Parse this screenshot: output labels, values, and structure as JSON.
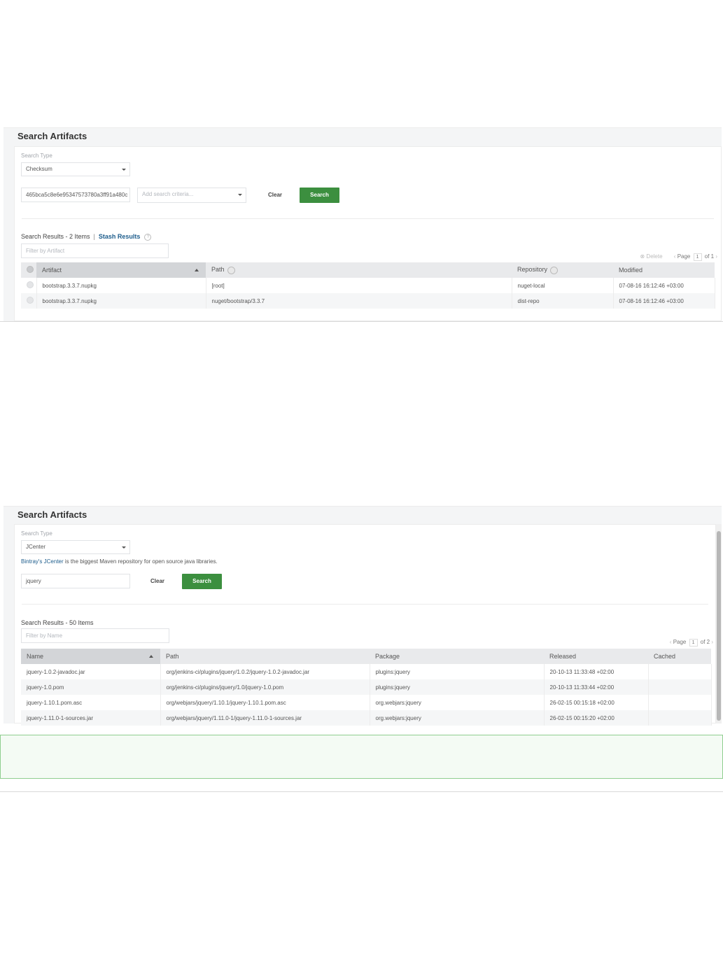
{
  "panel1": {
    "title": "Search Artifacts",
    "search_type_label": "Search Type",
    "search_type_value": "Checksum",
    "checksum_value": "465bca5c8e6e95347573780a3ff91a480c",
    "criteria_placeholder": "Add search criteria...",
    "clear_label": "Clear",
    "search_label": "Search",
    "results_title": "Search Results - 2 Items",
    "stash_label": "Stash Results",
    "filter_placeholder": "Filter by Artifact",
    "delete_label": "Delete",
    "page_label": "Page",
    "page_current": "1",
    "page_total": "of 1",
    "columns": [
      "Artifact",
      "Path",
      "Repository",
      "Modified"
    ],
    "rows": [
      {
        "artifact": "bootstrap.3.3.7.nupkg",
        "path": "[root]",
        "repository": "nuget-local",
        "modified": "07-08-16 16:12:46 +03:00"
      },
      {
        "artifact": "bootstrap.3.3.7.nupkg",
        "path": "nuget/bootstrap/3.3.7",
        "repository": "dist-repo",
        "modified": "07-08-16 16:12:46 +03:00"
      }
    ]
  },
  "panel2": {
    "title": "Search Artifacts",
    "search_type_label": "Search Type",
    "search_type_value": "JCenter",
    "desc_link": "Bintray's JCenter",
    "desc_rest": " is the biggest Maven repository for open source java libraries.",
    "query_value": "jquery",
    "clear_label": "Clear",
    "search_label": "Search",
    "results_title": "Search Results - 50 Items",
    "filter_placeholder": "Filter by Name",
    "page_label": "Page",
    "page_current": "1",
    "page_total": "of 2",
    "columns": [
      "Name",
      "Path",
      "Package",
      "Released",
      "Cached"
    ],
    "rows": [
      {
        "name": "jquery-1.0.2-javadoc.jar",
        "path": "org/jenkins-ci/plugins/jquery/1.0.2/jquery-1.0.2-javadoc.jar",
        "package": "plugins:jquery",
        "released": "20-10-13 11:33:48 +02:00",
        "cached": ""
      },
      {
        "name": "jquery-1.0.pom",
        "path": "org/jenkins-ci/plugins/jquery/1.0/jquery-1.0.pom",
        "package": "plugins:jquery",
        "released": "20-10-13 11:33:44 +02:00",
        "cached": ""
      },
      {
        "name": "jquery-1.10.1.pom.asc",
        "path": "org/webjars/jquery/1.10.1/jquery-1.10.1.pom.asc",
        "package": "org.webjars:jquery",
        "released": "26-02-15 00:15:18 +02:00",
        "cached": ""
      },
      {
        "name": "jquery-1.11.0-1-sources.jar",
        "path": "org/webjars/jquery/1.11.0-1/jquery-1.11.0-1-sources.jar",
        "package": "org.webjars:jquery",
        "released": "26-02-15 00:15:20 +02:00",
        "cached": ""
      }
    ]
  },
  "colors": {
    "accent_green": "#3c8f3f",
    "link_blue": "#1d5d8c",
    "note_border": "#8fce8f"
  }
}
